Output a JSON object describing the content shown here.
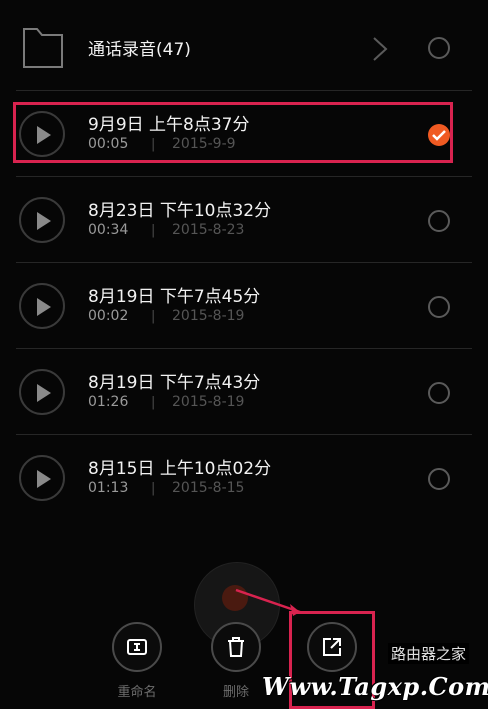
{
  "folder": {
    "title": "通话录音(47)",
    "icon": "folder-icon"
  },
  "recordings": [
    {
      "title": "9月9日 上午8点37分",
      "duration": "00:05",
      "separator": "|",
      "date": "2015-9-9",
      "selected": true
    },
    {
      "title": "8月23日 下午10点32分",
      "duration": "00:34",
      "separator": "|",
      "date": "2015-8-23",
      "selected": false
    },
    {
      "title": "8月19日 下午7点45分",
      "duration": "00:02",
      "separator": "|",
      "date": "2015-8-19",
      "selected": false
    },
    {
      "title": "8月19日 下午7点43分",
      "duration": "01:26",
      "separator": "|",
      "date": "2015-8-19",
      "selected": false
    },
    {
      "title": "8月15日 上午10点02分",
      "duration": "01:13",
      "separator": "|",
      "date": "2015-8-15",
      "selected": false
    }
  ],
  "actions": {
    "rename": {
      "label": "重命名",
      "icon": "rename-icon"
    },
    "delete": {
      "label": "删除",
      "icon": "trash-icon"
    },
    "share": {
      "label": "",
      "icon": "share-icon"
    }
  },
  "watermark": {
    "text": "Www.Tagxp.Com",
    "cn": "路由器之家"
  },
  "colors": {
    "accent": "#f05a22",
    "highlight": "#d8234f",
    "background": "#060606"
  }
}
